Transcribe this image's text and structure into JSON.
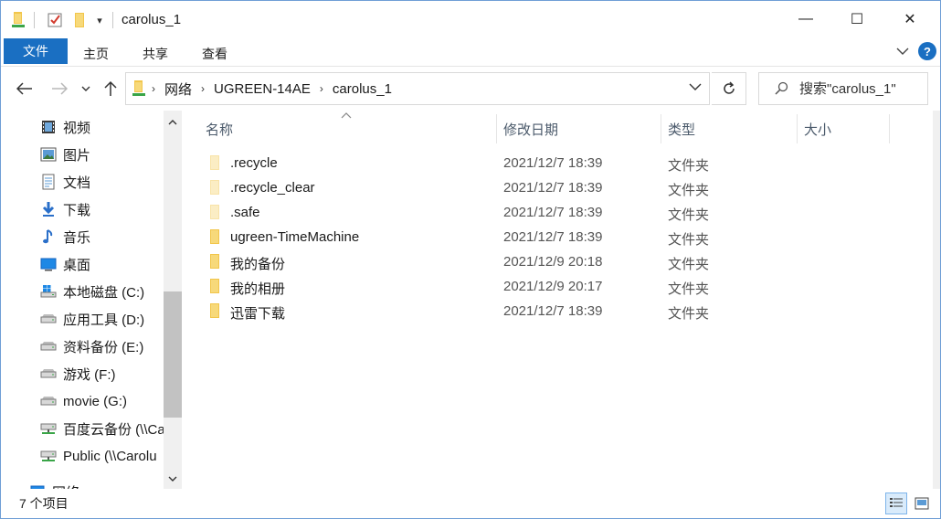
{
  "window": {
    "title": "carolus_1",
    "controls": {
      "minimize": "—",
      "maximize": "☐",
      "close": "✕"
    }
  },
  "ribbon": {
    "tabs": [
      {
        "label": "文件"
      },
      {
        "label": "主页"
      },
      {
        "label": "共享"
      },
      {
        "label": "查看"
      }
    ],
    "help": "?"
  },
  "navigation": {
    "breadcrumb": [
      "网络",
      "UGREEN-14AE",
      "carolus_1"
    ],
    "search_placeholder": "搜索\"carolus_1\""
  },
  "sidebar": {
    "items": [
      {
        "label": "视频",
        "icon": "video-icon"
      },
      {
        "label": "图片",
        "icon": "picture-icon"
      },
      {
        "label": "文档",
        "icon": "document-icon"
      },
      {
        "label": "下载",
        "icon": "download-icon"
      },
      {
        "label": "音乐",
        "icon": "music-icon"
      },
      {
        "label": "桌面",
        "icon": "desktop-icon"
      },
      {
        "label": "本地磁盘 (C:)",
        "icon": "windows-drive-icon"
      },
      {
        "label": "应用工具 (D:)",
        "icon": "drive-icon"
      },
      {
        "label": "资料备份 (E:)",
        "icon": "drive-icon"
      },
      {
        "label": "游戏 (F:)",
        "icon": "drive-icon"
      },
      {
        "label": "movie (G:)",
        "icon": "drive-icon"
      },
      {
        "label": "百度云备份 (\\\\Ca",
        "icon": "network-drive-icon"
      },
      {
        "label": "Public (\\\\Carolu",
        "icon": "network-drive-icon"
      },
      {
        "label": "网络",
        "icon": "network-icon"
      }
    ]
  },
  "filelist": {
    "columns": {
      "name": "名称",
      "date": "修改日期",
      "type": "类型",
      "size": "大小"
    },
    "rows": [
      {
        "name": ".recycle",
        "date": "2021/12/7 18:39",
        "type": "文件夹",
        "hidden": true
      },
      {
        "name": ".recycle_clear",
        "date": "2021/12/7 18:39",
        "type": "文件夹",
        "hidden": true
      },
      {
        "name": ".safe",
        "date": "2021/12/7 18:39",
        "type": "文件夹",
        "hidden": true
      },
      {
        "name": "ugreen-TimeMachine",
        "date": "2021/12/7 18:39",
        "type": "文件夹",
        "hidden": false
      },
      {
        "name": "我的备份",
        "date": "2021/12/9 20:18",
        "type": "文件夹",
        "hidden": false
      },
      {
        "name": "我的相册",
        "date": "2021/12/9 20:17",
        "type": "文件夹",
        "hidden": false
      },
      {
        "name": "迅雷下载",
        "date": "2021/12/7 18:39",
        "type": "文件夹",
        "hidden": false
      }
    ]
  },
  "status": {
    "item_count": "7 个项目"
  },
  "colors": {
    "accent": "#1a6fc2",
    "folder": "#f2c64b",
    "folder_hidden": "#f8e3a8"
  }
}
